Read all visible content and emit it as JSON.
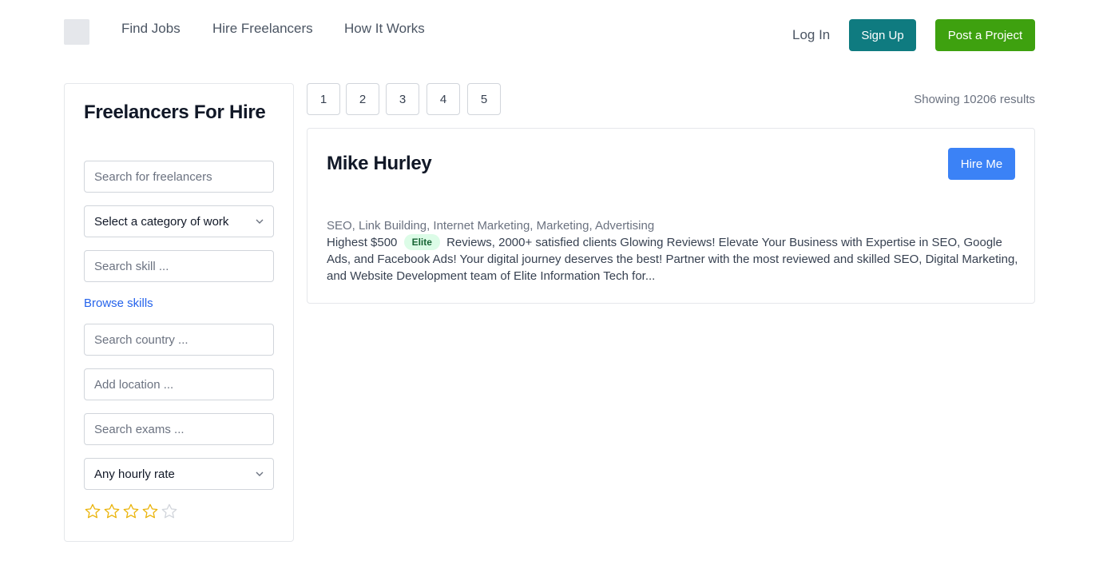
{
  "header": {
    "nav": [
      "Find Jobs",
      "Hire Freelancers",
      "How It Works"
    ],
    "login_label": "Log In",
    "signup_label": "Sign Up",
    "post_label": "Post a Project",
    "colors": {
      "signup": "#0f7b80",
      "post": "#3ea10f"
    }
  },
  "sidebar": {
    "title": "Freelancers For Hire",
    "search_placeholder": "Search for freelancers",
    "category_select": "Select a category of work",
    "skill_placeholder": "Search skill ...",
    "browse_skills": "Browse skills",
    "country_placeholder": "Search country ...",
    "location_placeholder": "Add location ...",
    "exams_placeholder": "Search exams ...",
    "rate_select": "Any hourly rate",
    "rating": {
      "value": 4,
      "max": 5
    }
  },
  "pagination": {
    "pages": [
      "1",
      "2",
      "3",
      "4",
      "5"
    ],
    "results_text": "Showing 10206 results"
  },
  "card": {
    "name": "Mike Hurley",
    "hire_label": "Hire Me",
    "skills": "SEO, Link Building, Internet Marketing, Marketing, Advertising",
    "desc_prefix": "Highest $500",
    "badge": "Elite",
    "desc_rest": "Reviews, 2000+ satisfied clients Glowing Reviews! Elevate Your Business with Expertise in SEO, Google Ads, and Facebook Ads! Your digital journey deserves the best! Partner with the most reviewed and skilled SEO, Digital Marketing, and Website Development team of Elite Information Tech for...",
    "hire_color": "#3b82f6"
  }
}
